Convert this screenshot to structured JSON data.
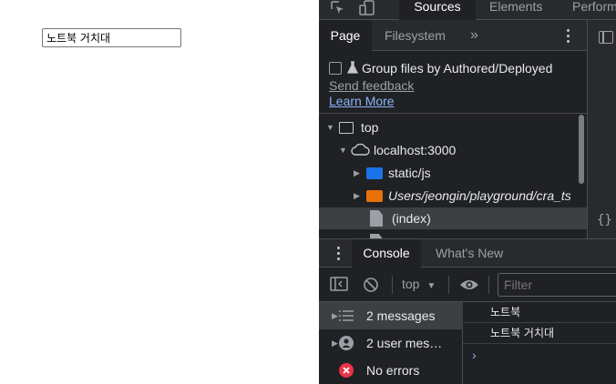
{
  "page": {
    "input_value": "노트북 거치대"
  },
  "devtools": {
    "main_tabs": [
      "Sources",
      "Elements",
      "Performance"
    ],
    "navigator": {
      "tabs": [
        "Page",
        "Filesystem"
      ],
      "more_tabs": "»",
      "group_files_label": "Group files by Authored/Deployed",
      "send_feedback": "Send feedback",
      "learn_more": "Learn More",
      "tree": [
        "top",
        "localhost:3000",
        "static/js",
        "Users/jeongin/playground/cra_ts",
        "(index)"
      ]
    },
    "drawer_tabs": [
      "Console",
      "What's New"
    ],
    "console": {
      "context": "top",
      "filter_placeholder": "Filter",
      "sidebar": [
        "2 messages",
        "2 user mes…",
        "No errors"
      ],
      "logs": [
        "노트북",
        "노트북 거치대"
      ],
      "prompt": "›"
    },
    "colors": {
      "background": "#202124",
      "toolbar": "#292a2d",
      "link": "#8ab4f8",
      "folder_blue": "#1a73e8",
      "folder_orange": "#e8710a",
      "error_red": "#f28b82"
    }
  }
}
